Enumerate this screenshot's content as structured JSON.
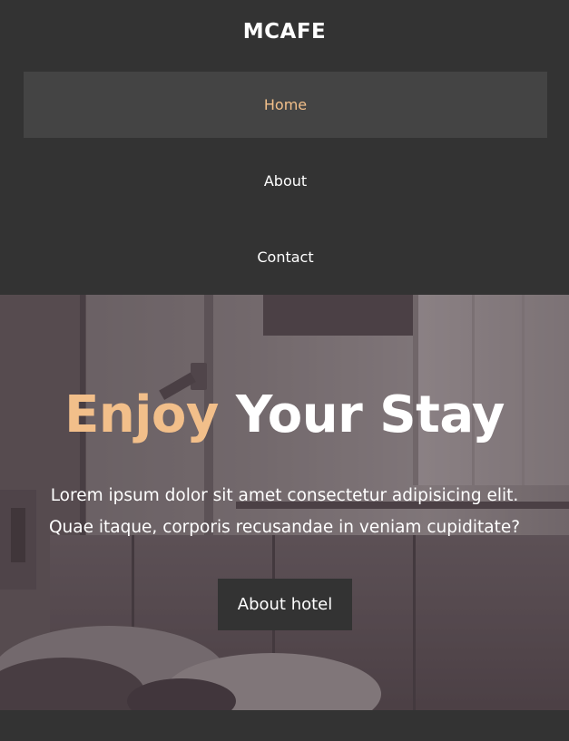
{
  "header": {
    "brand": "MCAFE",
    "nav": [
      {
        "label": "Home",
        "active": true
      },
      {
        "label": "About",
        "active": false
      },
      {
        "label": "Contact",
        "active": false
      }
    ]
  },
  "hero": {
    "title_accent": "Enjoy",
    "title_rest": "Your Stay",
    "text_line1": "Lorem ipsum dolor sit amet consectetur adipisicing elit.",
    "text_line2": "Quae itaque, corporis recusandae in veniam cupiditate?",
    "button_label": "About hotel",
    "image_icon": "hotel-room-photo"
  },
  "colors": {
    "background": "#333333",
    "nav_active_bg": "#444444",
    "accent": "#f2bf8a",
    "text": "#ffffff"
  }
}
